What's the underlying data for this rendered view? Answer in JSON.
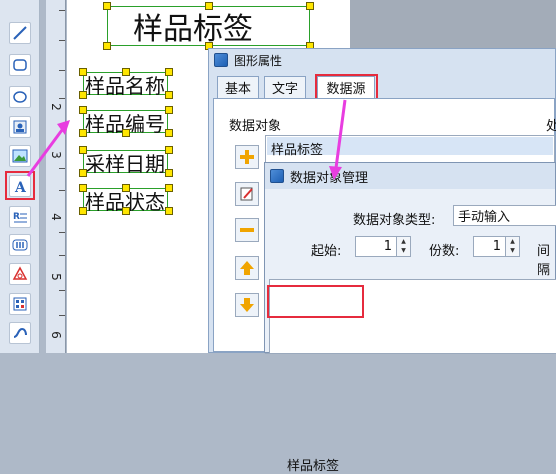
{
  "canvas": {
    "title_label": "样品标签",
    "labels": [
      "样品名称",
      "样品编号",
      "采样日期",
      "样品状态"
    ],
    "ruler_numbers": [
      "2",
      "3",
      "4",
      "5",
      "6"
    ]
  },
  "toolbar": {
    "tools": [
      "line-icon",
      "rounded-rect-icon",
      "ellipse-icon",
      "image-icon",
      "picture-icon",
      "text-icon",
      "multiline-text-icon",
      "barcode-icon",
      "shape-icon",
      "qrcode-icon",
      "curve-icon"
    ]
  },
  "props_dialog": {
    "title": "图形属性",
    "tabs": [
      "基本",
      "文字",
      "数据源"
    ],
    "data_object_label": "数据对象",
    "process_label": "处",
    "list_items": [
      "样品标签"
    ]
  },
  "manager_dialog": {
    "title": "数据对象管理",
    "type_label": "数据对象类型:",
    "type_value": "手动输入",
    "start_label": "起始:",
    "start_value": "1",
    "count_label": "份数:",
    "count_value": "1",
    "interval_label": "间隔",
    "content_value": "样品标签"
  },
  "colors": {
    "highlight": "#e62b3d",
    "arrow": "#e83de0",
    "handle": "#ffe600"
  }
}
